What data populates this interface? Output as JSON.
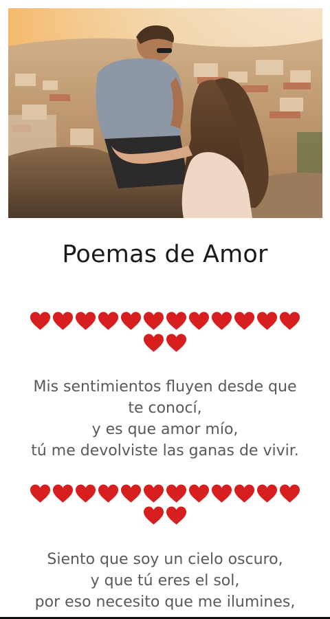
{
  "app": {
    "title": "Poemas de Amor",
    "colors": {
      "heart": "#d81f1f",
      "title_text": "#1a1a1a",
      "poem_text": "#595959",
      "background": "#ffffff"
    }
  },
  "hero_image": {
    "icon": "couple-photo"
  },
  "separators": [
    {
      "icon": "red-heart-icon",
      "count": 14,
      "glyph": "❤"
    },
    {
      "icon": "red-heart-icon",
      "count": 14,
      "glyph": "❤"
    }
  ],
  "poems": [
    {
      "lines": [
        "Mis sentimientos fluyen desde que",
        "te conocí,",
        "y es que amor mío,",
        "tú me devolviste las ganas de vivir."
      ]
    },
    {
      "lines": [
        "Siento que soy un cielo oscuro,",
        "y que tú eres el sol,",
        "por eso necesito que me ilumines,"
      ]
    }
  ]
}
